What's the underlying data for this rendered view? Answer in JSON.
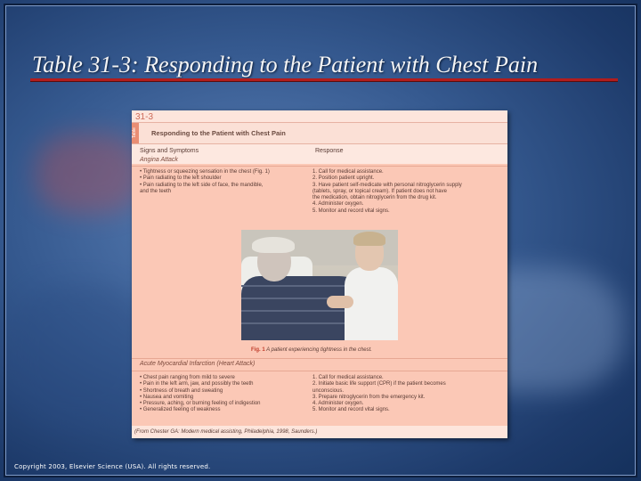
{
  "slide": {
    "title": "Table 31-3: Responding to the Patient with Chest Pain",
    "copyright": "Copyright 2003, Elsevier Science (USA). All rights reserved."
  },
  "table": {
    "number": "31-3",
    "tag": "Table",
    "title": "Responding to the Patient with Chest Pain",
    "col_left": "Signs and Symptoms",
    "col_right": "Response",
    "sections": [
      {
        "heading": "Angina Attack",
        "signs": [
          "• Tightness or squeezing sensation in the chest (Fig. 1)",
          "• Pain radiating to the left shoulder",
          "• Pain radiating to the left side of face, the mandible,",
          "  and the teeth"
        ],
        "responses": [
          "1.  Call for medical assistance.",
          "2.  Position patient upright.",
          "3.  Have patient self-medicate with personal nitroglycerin supply",
          "     (tablets, spray, or topical cream). If patient does not have",
          "     the medication, obtain nitroglycerin from the drug kit.",
          "4.  Administer oxygen.",
          "5.  Monitor and record vital signs."
        ]
      },
      {
        "heading": "Acute Myocardial Infarction (Heart Attack)",
        "signs": [
          "• Chest pain ranging from mild to severe",
          "• Pain in the left arm, jaw, and possibly the teeth",
          "• Shortness of breath and sweating",
          "• Nausea and vomiting",
          "• Pressure, aching, or burning feeling of indigestion",
          "• Generalized feeling of weakness"
        ],
        "responses": [
          "1.  Call for medical assistance.",
          "2.  Initiate basic life support (CPR) if the patient becomes",
          "     unconscious.",
          "3.  Prepare nitroglycerin from the emergency kit.",
          "4.  Administer oxygen.",
          "5.  Monitor and record vital signs."
        ]
      }
    ],
    "figure_num": "Fig. 1",
    "figure_caption": "A patient experiencing tightness in the chest.",
    "source": "(From Chester GA: Modern medical assisting, Philadelphia, 1998, Saunders.)"
  }
}
